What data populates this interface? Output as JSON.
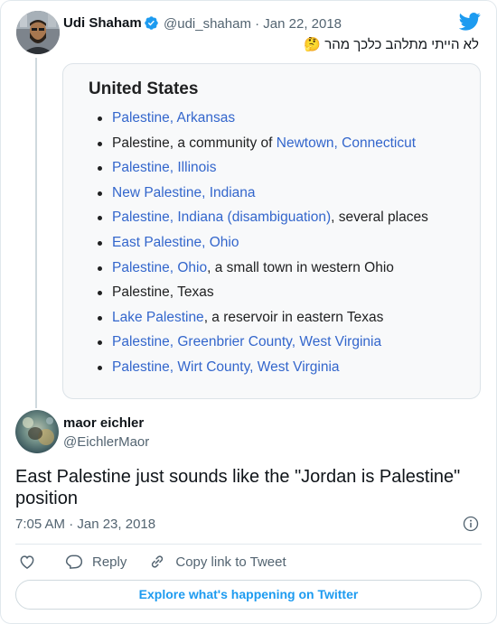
{
  "parent": {
    "name": "Udi Shaham",
    "handle_date": "@udi_shaham · Jan 22, 2018",
    "text": "לא הייתי מתלהב כלכך מהר 🤔"
  },
  "embed": {
    "title": "United States",
    "items": [
      [
        {
          "t": "Palestine, Arkansas",
          "c": "lnk"
        }
      ],
      [
        {
          "t": "Palestine, a community of ",
          "c": ""
        },
        {
          "t": "Newtown, Connecticut",
          "c": "lnk"
        }
      ],
      [
        {
          "t": "Palestine, Illinois",
          "c": "lnk"
        }
      ],
      [
        {
          "t": "New Palestine, Indiana",
          "c": "lnk"
        }
      ],
      [
        {
          "t": "Palestine, Indiana (disambiguation)",
          "c": "lnk"
        },
        {
          "t": ", several places",
          "c": ""
        }
      ],
      [
        {
          "t": "East Palestine, Ohio",
          "c": "lnk"
        }
      ],
      [
        {
          "t": "Palestine, Ohio",
          "c": "lnk"
        },
        {
          "t": ", a small town in western Ohio",
          "c": ""
        }
      ],
      [
        {
          "t": "Palestine, Texas",
          "c": "lnkd"
        }
      ],
      [
        {
          "t": "Lake Palestine",
          "c": "lnk"
        },
        {
          "t": ", a reservoir in eastern Texas",
          "c": ""
        }
      ],
      [
        {
          "t": "Palestine, Greenbrier County, West Virginia",
          "c": "lnk"
        }
      ],
      [
        {
          "t": "Palestine, Wirt County, West Virginia",
          "c": "lnk"
        }
      ]
    ]
  },
  "reply": {
    "name": "maor eichler",
    "handle": "@EichlerMaor",
    "text": "East Palestine just sounds like the \"Jordan is Palestine\" position",
    "timestamp": "7:05 AM · Jan 23, 2018"
  },
  "actions": {
    "reply_label": "Reply",
    "copy_label": "Copy link to Tweet"
  },
  "explore_label": "Explore what's happening on Twitter",
  "colors": {
    "twitter_blue": "#1d9bf0",
    "verified_blue": "#1d9bf0",
    "wiki_link": "#3366cc",
    "muted_text": "#536471"
  }
}
